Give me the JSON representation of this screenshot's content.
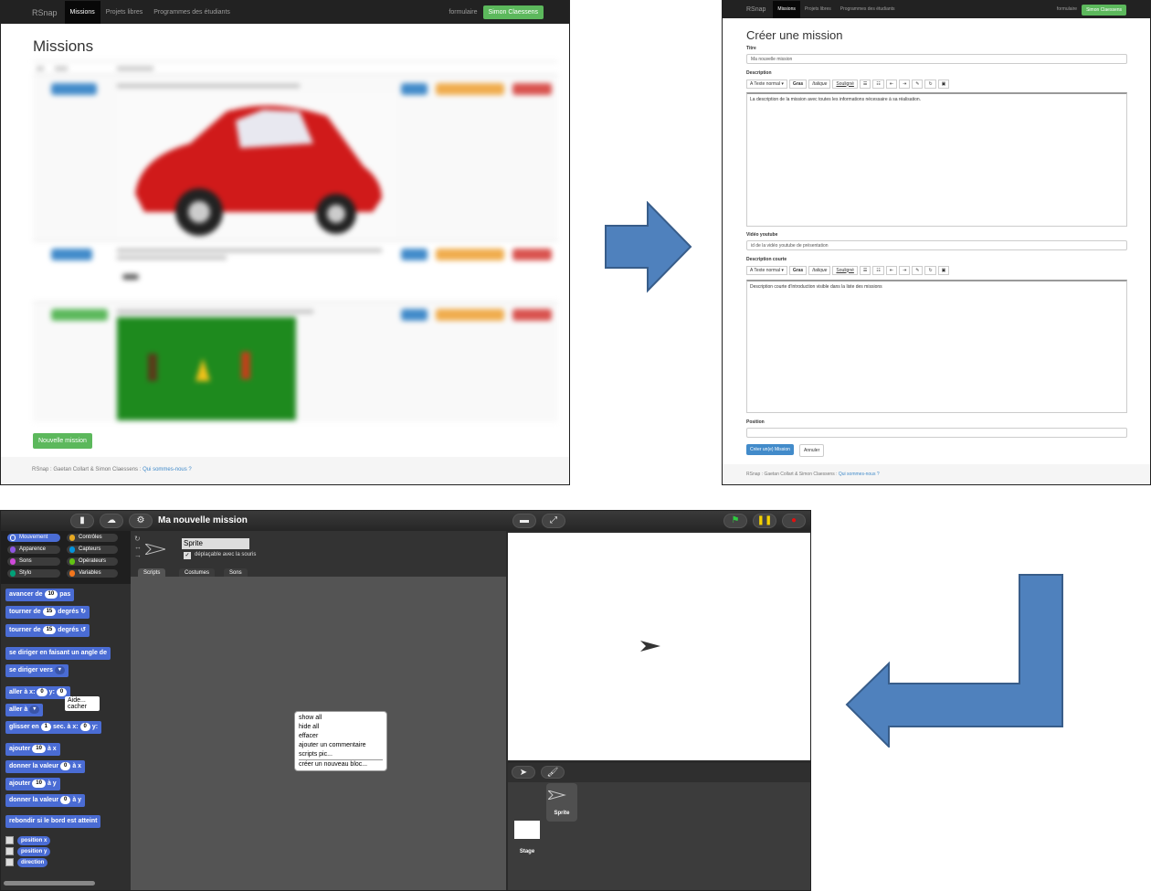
{
  "panel1": {
    "brand": "RSnap",
    "nav": [
      "Missions",
      "Projets libres",
      "Programmes des étudiants"
    ],
    "nav_right_link": "formulaire",
    "user_button": "Simon Claessens",
    "title": "Missions",
    "new_mission_button": "Nouvelle mission",
    "footer_text": "RSnap : Gaetan Collart & Simon Claessens :",
    "footer_link": "Qui sommes-nous ?"
  },
  "panel2": {
    "brand": "RSnap",
    "nav": [
      "Missions",
      "Projets libres",
      "Programmes des étudiants"
    ],
    "nav_right_link": "formulaire",
    "user_button": "Simon Claessens",
    "title": "Créer une mission",
    "title_label": "Titre",
    "title_value": "Ma nouvelle mission",
    "description_label": "Description",
    "toolbar": {
      "style": "A Texte normal ▾",
      "bold": "Gras",
      "italic": "Italique",
      "underline": "Souligné"
    },
    "description_value": "La description de la mission avec toutes les informations nécessaire à sa réalisation.",
    "video_label": "Vidéo youtube",
    "video_placeholder": "id de la vidéo youtube de présentation",
    "short_desc_label": "Description courte",
    "short_desc_value": "Description courte d'introduction visible dans la liste des missions",
    "position_label": "Position",
    "submit_button": "Créer un(e) Mission",
    "cancel_button": "Annuler",
    "footer_text": "RSnap : Gaetan Collart & Simon Claessens :",
    "footer_link": "Qui sommes-nous ?"
  },
  "panel3": {
    "project_title": "Ma nouvelle mission",
    "categories": [
      "Mouvement",
      "Contrôles",
      "Apparence",
      "Capteurs",
      "Sons",
      "Opérateurs",
      "Stylo",
      "Variables"
    ],
    "category_colors": [
      "#4a6cd4",
      "#e6a822",
      "#8f56e3",
      "#0494dc",
      "#cf4ad9",
      "#62c213",
      "#00a178",
      "#f3761d"
    ],
    "sprite_name": "Sprite",
    "draggable_label": "déplaçable avec la souris",
    "tabs": [
      "Scripts",
      "Costumes",
      "Sons"
    ],
    "blocks": {
      "b1": "avancer de",
      "b1v": "10",
      "b1s": "pas",
      "b2": "tourner de",
      "b2v": "15",
      "b2s": "degrés ↻",
      "b3": "tourner de",
      "b3v": "15",
      "b3s": "degrés ↺",
      "b4": "se diriger en faisant un angle de",
      "b5": "se diriger vers",
      "b6": "aller à x:",
      "b6v": "0",
      "b6s": "y:",
      "b6v2": "0",
      "b7": "aller à",
      "b8": "glisser en",
      "b8v": "1",
      "b8s": "sec. à x:",
      "b8v2": "0",
      "b8s2": "y:",
      "b9": "ajouter",
      "b9v": "10",
      "b9s": "à x",
      "b10": "donner la valeur",
      "b10v": "0",
      "b10s": "à x",
      "b11": "ajouter",
      "b11v": "10",
      "b11s": "à y",
      "b12": "donner la valeur",
      "b12v": "0",
      "b12s": "à y",
      "b13": "rebondir si le bord est atteint"
    },
    "reporters": [
      "position x",
      "position y",
      "direction"
    ],
    "tooltip": [
      "Aide...",
      "cacher"
    ],
    "context_menu": [
      "show all",
      "hide all",
      "effacer",
      "ajouter un commentaire",
      "scripts pic...",
      "créer un nouveau bloc..."
    ],
    "corral_sprite": "Sprite",
    "corral_stage": "Stage"
  },
  "colors": {
    "arrow": "#4f81bd",
    "arrow_border": "#385d8a",
    "navbar": "#222222",
    "green": "#5cb85c",
    "blue": "#428bca"
  }
}
